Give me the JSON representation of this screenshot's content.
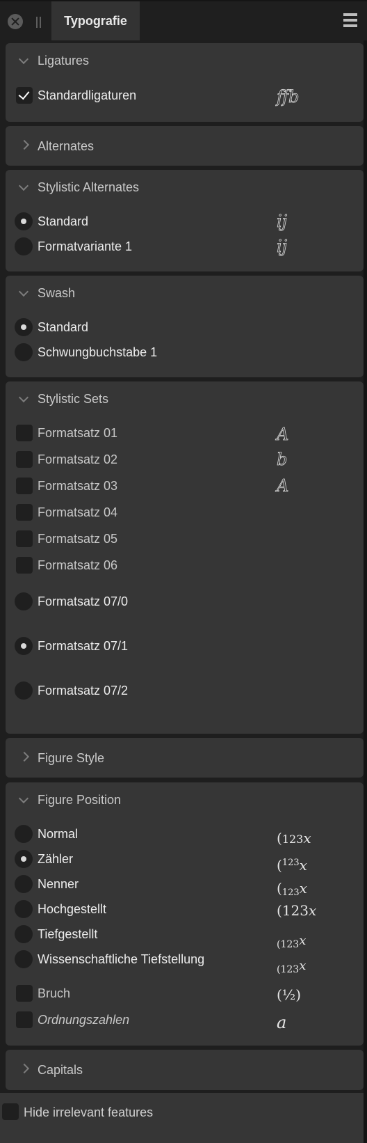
{
  "panel": {
    "tab_title": "Typografie",
    "close_icon": "close-circle-icon",
    "grip_icon": "drag-grip-icon",
    "menu_icon": "hamburger-menu-icon"
  },
  "sections": {
    "ligatures": {
      "title": "Ligatures",
      "expanded": true,
      "items": [
        {
          "label": "Standardligaturen",
          "type": "checkbox",
          "checked": true,
          "preview": "ffb"
        }
      ]
    },
    "alternates": {
      "title": "Alternates",
      "expanded": false
    },
    "stylistic_alternates": {
      "title": "Stylistic Alternates",
      "expanded": true,
      "items": [
        {
          "label": "Standard",
          "type": "radio",
          "selected": true,
          "preview": "ij"
        },
        {
          "label": "Formatvariante 1",
          "type": "radio",
          "selected": false,
          "preview": "ij"
        }
      ]
    },
    "swash": {
      "title": "Swash",
      "expanded": true,
      "items": [
        {
          "label": "Standard",
          "type": "radio",
          "selected": true
        },
        {
          "label": "Schwungbuchstabe 1",
          "type": "radio",
          "selected": false
        }
      ]
    },
    "stylistic_sets": {
      "title": "Stylistic Sets",
      "expanded": true,
      "items": [
        {
          "label": "Formatsatz 01",
          "type": "checkbox",
          "checked": false,
          "preview": "A"
        },
        {
          "label": "Formatsatz 02",
          "type": "checkbox",
          "checked": false,
          "preview": "b"
        },
        {
          "label": "Formatsatz 03",
          "type": "checkbox",
          "checked": false,
          "preview": "A"
        },
        {
          "label": "Formatsatz 04",
          "type": "checkbox",
          "checked": false
        },
        {
          "label": "Formatsatz 05",
          "type": "checkbox",
          "checked": false
        },
        {
          "label": "Formatsatz 06",
          "type": "checkbox",
          "checked": false
        },
        {
          "label": "Formatsatz 07/0",
          "type": "radio",
          "selected": false
        },
        {
          "label": "Formatsatz 07/1",
          "type": "radio",
          "selected": true
        },
        {
          "label": "Formatsatz 07/2",
          "type": "radio",
          "selected": false
        }
      ]
    },
    "figure_style": {
      "title": "Figure Style",
      "expanded": false
    },
    "figure_position": {
      "title": "Figure Position",
      "expanded": true,
      "items": [
        {
          "label": "Normal",
          "type": "radio",
          "selected": false,
          "preview": "(123x"
        },
        {
          "label": "Zähler",
          "type": "radio",
          "selected": true,
          "preview": "(123x"
        },
        {
          "label": "Nenner",
          "type": "radio",
          "selected": false,
          "preview": "(123x"
        },
        {
          "label": "Hochgestellt",
          "type": "radio",
          "selected": false,
          "preview": "(123x"
        },
        {
          "label": "Tiefgestellt",
          "type": "radio",
          "selected": false,
          "preview": "(123x"
        },
        {
          "label": "Wissenschaftliche Tiefstellung",
          "type": "radio",
          "selected": false,
          "preview": "(123x"
        },
        {
          "label": "Bruch",
          "type": "checkbox",
          "checked": false,
          "preview": "(½)"
        },
        {
          "label": "Ordnungszahlen",
          "type": "checkbox",
          "checked": false,
          "preview": "a"
        }
      ]
    },
    "capitals": {
      "title": "Capitals",
      "expanded": false
    }
  },
  "preview_parts": {
    "paren": "(",
    "digits": "123",
    "x": "x"
  },
  "footer": {
    "hide_irrelevant_label": "Hide irrelevant features",
    "checked": false
  }
}
